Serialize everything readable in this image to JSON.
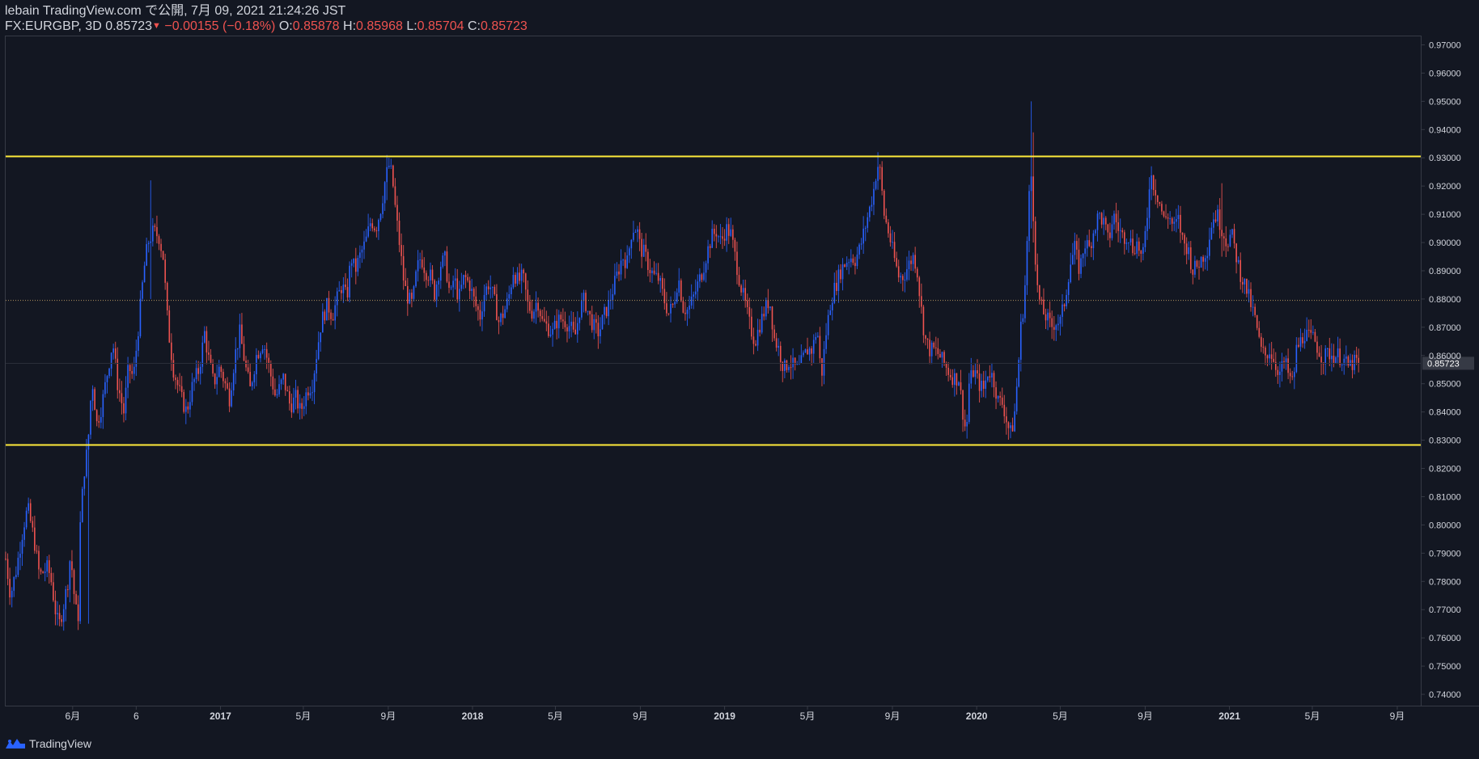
{
  "header": {
    "published_line": "lebain TradingView.com で公開, 7月 09, 2021 21:24:26 JST",
    "symbol_timeframe": "FX:EURGBP, 3D",
    "last": "0.85723",
    "down_marker": "▼",
    "change": "−0.00155 (−0.18%)",
    "o_label": "O:",
    "o_value": "0.85878",
    "h_label": "H:",
    "h_value": "0.85968",
    "l_label": "L:",
    "l_value": "0.85704",
    "c_label": "C:",
    "c_value": "0.85723"
  },
  "footer": {
    "brand": "TradingView",
    "logo_icon": "tradingview-logo-icon"
  },
  "colors": {
    "background": "#131722",
    "up": "#2962ff",
    "down": "#ef5350",
    "hline": "#ffeb3b",
    "text": "#d1d4dc",
    "axis": "#363a45"
  },
  "chart_data": {
    "type": "candlestick",
    "symbol": "FX:EURGBP",
    "timeframe": "3D",
    "y_ticks": [
      "0.97000",
      "0.96000",
      "0.95000",
      "0.94000",
      "0.93000",
      "0.92000",
      "0.91000",
      "0.90000",
      "0.89000",
      "0.88000",
      "0.87000",
      "0.86000",
      "0.85000",
      "0.84000",
      "0.83000",
      "0.82000",
      "0.81000",
      "0.80000",
      "0.79000",
      "0.78000",
      "0.77000",
      "0.76000",
      "0.75000",
      "0.74000"
    ],
    "ylim": [
      0.736,
      0.973
    ],
    "x_ticks": [
      {
        "label": "6月",
        "date": "2016-06-01"
      },
      {
        "label": "6",
        "date": "2016-09-01"
      },
      {
        "label": "2017",
        "date": "2017-01-01"
      },
      {
        "label": "5月",
        "date": "2017-05-01"
      },
      {
        "label": "9月",
        "date": "2017-09-01"
      },
      {
        "label": "2018",
        "date": "2018-01-01"
      },
      {
        "label": "5月",
        "date": "2018-05-01"
      },
      {
        "label": "9月",
        "date": "2018-09-01"
      },
      {
        "label": "2019",
        "date": "2019-01-01"
      },
      {
        "label": "5月",
        "date": "2019-05-01"
      },
      {
        "label": "9月",
        "date": "2019-09-01"
      },
      {
        "label": "2020",
        "date": "2020-01-01"
      },
      {
        "label": "5月",
        "date": "2020-05-01"
      },
      {
        "label": "9月",
        "date": "2020-09-01"
      },
      {
        "label": "2021",
        "date": "2021-01-01"
      },
      {
        "label": "5月",
        "date": "2021-05-01"
      },
      {
        "label": "9月",
        "date": "2021-09-01"
      }
    ],
    "x_range": [
      "2016-02-25",
      "2021-10-05"
    ],
    "bar_days": 3,
    "horizontal_lines": [
      {
        "price": 0.9305,
        "color": "#ffeb3b"
      },
      {
        "price": 0.8283,
        "color": "#ffeb3b"
      }
    ],
    "dotted_line": {
      "price": 0.8795,
      "color": "#b2935f"
    },
    "last_price": {
      "value": 0.85723,
      "label": "0.85723"
    },
    "last_bar_date": "2021-07-09",
    "close_path": [
      [
        "2016-02-25",
        0.788
      ],
      [
        "2016-03-03",
        0.775
      ],
      [
        "2016-03-12",
        0.785
      ],
      [
        "2016-03-22",
        0.8
      ],
      [
        "2016-03-28",
        0.806
      ],
      [
        "2016-04-06",
        0.795
      ],
      [
        "2016-04-14",
        0.782
      ],
      [
        "2016-04-26",
        0.785
      ],
      [
        "2016-05-01",
        0.78
      ],
      [
        "2016-05-08",
        0.768
      ],
      [
        "2016-05-12",
        0.764
      ],
      [
        "2016-05-20",
        0.773
      ],
      [
        "2016-05-25",
        0.78
      ],
      [
        "2016-05-29",
        0.79
      ],
      [
        "2016-06-05",
        0.77
      ],
      [
        "2016-06-09",
        0.768
      ],
      [
        "2016-06-12",
        0.8
      ],
      [
        "2016-06-17",
        0.818
      ],
      [
        "2016-06-23",
        0.828
      ],
      [
        "2016-06-29",
        0.852
      ],
      [
        "2016-07-06",
        0.836
      ],
      [
        "2016-07-13",
        0.842
      ],
      [
        "2016-07-22",
        0.855
      ],
      [
        "2016-07-29",
        0.865
      ],
      [
        "2016-08-05",
        0.85
      ],
      [
        "2016-08-14",
        0.84
      ],
      [
        "2016-08-21",
        0.856
      ],
      [
        "2016-08-28",
        0.852
      ],
      [
        "2016-09-05",
        0.872
      ],
      [
        "2016-09-12",
        0.89
      ],
      [
        "2016-09-18",
        0.9
      ],
      [
        "2016-09-26",
        0.904
      ],
      [
        "2016-10-04",
        0.902
      ],
      [
        "2016-10-10",
        0.895
      ],
      [
        "2016-10-17",
        0.87
      ],
      [
        "2016-10-25",
        0.855
      ],
      [
        "2016-11-05",
        0.845
      ],
      [
        "2016-11-13",
        0.84
      ],
      [
        "2016-11-22",
        0.85
      ],
      [
        "2016-12-01",
        0.855
      ],
      [
        "2016-12-09",
        0.868
      ],
      [
        "2016-12-14",
        0.86
      ],
      [
        "2016-12-22",
        0.85
      ],
      [
        "2016-12-31",
        0.856
      ],
      [
        "2017-01-14",
        0.845
      ],
      [
        "2017-01-22",
        0.86
      ],
      [
        "2017-01-29",
        0.868
      ],
      [
        "2017-02-07",
        0.855
      ],
      [
        "2017-02-13",
        0.848
      ],
      [
        "2017-02-22",
        0.86
      ],
      [
        "2017-03-04",
        0.865
      ],
      [
        "2017-03-13",
        0.855
      ],
      [
        "2017-03-22",
        0.845
      ],
      [
        "2017-04-02",
        0.852
      ],
      [
        "2017-04-12",
        0.842
      ],
      [
        "2017-04-20",
        0.845
      ],
      [
        "2017-04-27",
        0.84
      ],
      [
        "2017-05-07",
        0.848
      ],
      [
        "2017-05-14",
        0.85
      ],
      [
        "2017-05-21",
        0.862
      ],
      [
        "2017-05-27",
        0.872
      ],
      [
        "2017-06-05",
        0.878
      ],
      [
        "2017-06-12",
        0.874
      ],
      [
        "2017-06-19",
        0.88
      ],
      [
        "2017-06-26",
        0.885
      ],
      [
        "2017-07-03",
        0.88
      ],
      [
        "2017-07-09",
        0.895
      ],
      [
        "2017-07-15",
        0.89
      ],
      [
        "2017-07-23",
        0.896
      ],
      [
        "2017-07-30",
        0.9
      ],
      [
        "2017-08-07",
        0.908
      ],
      [
        "2017-08-14",
        0.905
      ],
      [
        "2017-08-22",
        0.913
      ],
      [
        "2017-08-28",
        0.923
      ],
      [
        "2017-09-03",
        0.928
      ],
      [
        "2017-09-08",
        0.92
      ],
      [
        "2017-09-12",
        0.91
      ],
      [
        "2017-09-18",
        0.898
      ],
      [
        "2017-09-24",
        0.885
      ],
      [
        "2017-09-30",
        0.88
      ],
      [
        "2017-10-06",
        0.878
      ],
      [
        "2017-10-12",
        0.89
      ],
      [
        "2017-10-18",
        0.895
      ],
      [
        "2017-10-25",
        0.89
      ],
      [
        "2017-11-01",
        0.888
      ],
      [
        "2017-11-07",
        0.882
      ],
      [
        "2017-11-15",
        0.892
      ],
      [
        "2017-11-22",
        0.894
      ],
      [
        "2017-11-30",
        0.88
      ],
      [
        "2017-12-05",
        0.888
      ],
      [
        "2017-12-12",
        0.88
      ],
      [
        "2017-12-20",
        0.888
      ],
      [
        "2017-12-28",
        0.885
      ],
      [
        "2018-01-05",
        0.878
      ],
      [
        "2018-01-12",
        0.874
      ],
      [
        "2018-01-18",
        0.882
      ],
      [
        "2018-01-25",
        0.886
      ],
      [
        "2018-02-01",
        0.88
      ],
      [
        "2018-02-08",
        0.872
      ],
      [
        "2018-02-15",
        0.875
      ],
      [
        "2018-02-22",
        0.88
      ],
      [
        "2018-03-01",
        0.89
      ],
      [
        "2018-03-08",
        0.886
      ],
      [
        "2018-03-15",
        0.888
      ],
      [
        "2018-03-22",
        0.878
      ],
      [
        "2018-03-29",
        0.875
      ],
      [
        "2018-04-05",
        0.88
      ],
      [
        "2018-04-12",
        0.872
      ],
      [
        "2018-04-20",
        0.87
      ],
      [
        "2018-04-27",
        0.868
      ],
      [
        "2018-05-03",
        0.872
      ],
      [
        "2018-05-09",
        0.873
      ],
      [
        "2018-05-16",
        0.872
      ],
      [
        "2018-05-23",
        0.87
      ],
      [
        "2018-05-29",
        0.866
      ],
      [
        "2018-06-05",
        0.876
      ],
      [
        "2018-06-12",
        0.88
      ],
      [
        "2018-06-19",
        0.874
      ],
      [
        "2018-06-26",
        0.87
      ],
      [
        "2018-07-03",
        0.868
      ],
      [
        "2018-07-10",
        0.874
      ],
      [
        "2018-07-17",
        0.878
      ],
      [
        "2018-07-24",
        0.884
      ],
      [
        "2018-07-31",
        0.89
      ],
      [
        "2018-08-06",
        0.895
      ],
      [
        "2018-08-13",
        0.893
      ],
      [
        "2018-08-20",
        0.905
      ],
      [
        "2018-08-27",
        0.905
      ],
      [
        "2018-09-01",
        0.898
      ],
      [
        "2018-09-07",
        0.896
      ],
      [
        "2018-09-14",
        0.891
      ],
      [
        "2018-09-21",
        0.888
      ],
      [
        "2018-09-28",
        0.887
      ],
      [
        "2018-10-05",
        0.88
      ],
      [
        "2018-10-12",
        0.875
      ],
      [
        "2018-10-19",
        0.878
      ],
      [
        "2018-10-26",
        0.888
      ],
      [
        "2018-11-02",
        0.877
      ],
      [
        "2018-11-09",
        0.876
      ],
      [
        "2018-11-16",
        0.88
      ],
      [
        "2018-11-23",
        0.885
      ],
      [
        "2018-11-30",
        0.89
      ],
      [
        "2018-12-06",
        0.896
      ],
      [
        "2018-12-13",
        0.902
      ],
      [
        "2018-12-20",
        0.904
      ],
      [
        "2018-12-27",
        0.9
      ],
      [
        "2019-01-03",
        0.905
      ],
      [
        "2019-01-10",
        0.903
      ],
      [
        "2019-01-17",
        0.894
      ],
      [
        "2019-01-24",
        0.885
      ],
      [
        "2019-01-31",
        0.878
      ],
      [
        "2019-02-07",
        0.87
      ],
      [
        "2019-02-14",
        0.865
      ],
      [
        "2019-02-21",
        0.871
      ],
      [
        "2019-02-28",
        0.876
      ],
      [
        "2019-03-07",
        0.88
      ],
      [
        "2019-03-14",
        0.866
      ],
      [
        "2019-03-21",
        0.862
      ],
      [
        "2019-03-28",
        0.855
      ],
      [
        "2019-04-04",
        0.858
      ],
      [
        "2019-04-11",
        0.856
      ],
      [
        "2019-04-18",
        0.855
      ],
      [
        "2019-04-25",
        0.859
      ],
      [
        "2019-05-01",
        0.862
      ],
      [
        "2019-05-08",
        0.862
      ],
      [
        "2019-05-15",
        0.87
      ],
      [
        "2019-05-21",
        0.852
      ],
      [
        "2019-05-28",
        0.868
      ],
      [
        "2019-06-04",
        0.88
      ],
      [
        "2019-06-11",
        0.885
      ],
      [
        "2019-06-18",
        0.89
      ],
      [
        "2019-06-25",
        0.893
      ],
      [
        "2019-07-02",
        0.895
      ],
      [
        "2019-07-09",
        0.894
      ],
      [
        "2019-07-16",
        0.898
      ],
      [
        "2019-07-23",
        0.905
      ],
      [
        "2019-07-30",
        0.912
      ],
      [
        "2019-08-06",
        0.92
      ],
      [
        "2019-08-10",
        0.928
      ],
      [
        "2019-08-14",
        0.925
      ],
      [
        "2019-08-20",
        0.91
      ],
      [
        "2019-08-27",
        0.903
      ],
      [
        "2019-09-03",
        0.895
      ],
      [
        "2019-09-10",
        0.888
      ],
      [
        "2019-09-17",
        0.888
      ],
      [
        "2019-09-24",
        0.892
      ],
      [
        "2019-10-01",
        0.895
      ],
      [
        "2019-10-06",
        0.892
      ],
      [
        "2019-10-12",
        0.878
      ],
      [
        "2019-10-18",
        0.866
      ],
      [
        "2019-10-25",
        0.862
      ],
      [
        "2019-11-01",
        0.862
      ],
      [
        "2019-11-08",
        0.86
      ],
      [
        "2019-11-15",
        0.857
      ],
      [
        "2019-11-22",
        0.854
      ],
      [
        "2019-11-29",
        0.852
      ],
      [
        "2019-12-06",
        0.852
      ],
      [
        "2019-12-13",
        0.838
      ],
      [
        "2019-12-17",
        0.832
      ],
      [
        "2019-12-21",
        0.85
      ],
      [
        "2019-12-28",
        0.855
      ],
      [
        "2020-01-04",
        0.85
      ],
      [
        "2020-01-11",
        0.848
      ],
      [
        "2020-01-18",
        0.855
      ],
      [
        "2020-01-25",
        0.852
      ],
      [
        "2020-02-01",
        0.844
      ],
      [
        "2020-02-08",
        0.843
      ],
      [
        "2020-02-15",
        0.835
      ],
      [
        "2020-02-20",
        0.832
      ],
      [
        "2020-02-25",
        0.84
      ],
      [
        "2020-03-01",
        0.855
      ],
      [
        "2020-03-05",
        0.87
      ],
      [
        "2020-03-10",
        0.88
      ],
      [
        "2020-03-15",
        0.905
      ],
      [
        "2020-03-19",
        0.928
      ],
      [
        "2020-03-23",
        0.91
      ],
      [
        "2020-03-28",
        0.885
      ],
      [
        "2020-04-02",
        0.878
      ],
      [
        "2020-04-07",
        0.875
      ],
      [
        "2020-04-12",
        0.873
      ],
      [
        "2020-04-18",
        0.87
      ],
      [
        "2020-04-24",
        0.872
      ],
      [
        "2020-05-01",
        0.872
      ],
      [
        "2020-05-08",
        0.88
      ],
      [
        "2020-05-15",
        0.892
      ],
      [
        "2020-05-22",
        0.898
      ],
      [
        "2020-05-29",
        0.89
      ],
      [
        "2020-06-05",
        0.9
      ],
      [
        "2020-06-12",
        0.898
      ],
      [
        "2020-06-19",
        0.905
      ],
      [
        "2020-06-26",
        0.91
      ],
      [
        "2020-07-03",
        0.907
      ],
      [
        "2020-07-10",
        0.9
      ],
      [
        "2020-07-17",
        0.91
      ],
      [
        "2020-07-24",
        0.905
      ],
      [
        "2020-07-31",
        0.902
      ],
      [
        "2020-08-07",
        0.903
      ],
      [
        "2020-08-14",
        0.898
      ],
      [
        "2020-08-21",
        0.9
      ],
      [
        "2020-08-28",
        0.893
      ],
      [
        "2020-09-04",
        0.91
      ],
      [
        "2020-09-08",
        0.925
      ],
      [
        "2020-09-14",
        0.92
      ],
      [
        "2020-09-21",
        0.915
      ],
      [
        "2020-09-28",
        0.908
      ],
      [
        "2020-10-05",
        0.91
      ],
      [
        "2020-10-12",
        0.905
      ],
      [
        "2020-10-19",
        0.908
      ],
      [
        "2020-10-26",
        0.9
      ],
      [
        "2020-11-02",
        0.898
      ],
      [
        "2020-11-09",
        0.89
      ],
      [
        "2020-11-16",
        0.892
      ],
      [
        "2020-11-23",
        0.895
      ],
      [
        "2020-11-30",
        0.898
      ],
      [
        "2020-12-07",
        0.908
      ],
      [
        "2020-12-14",
        0.91
      ],
      [
        "2020-12-21",
        0.905
      ],
      [
        "2020-12-28",
        0.9
      ],
      [
        "2021-01-04",
        0.903
      ],
      [
        "2021-01-11",
        0.895
      ],
      [
        "2021-01-18",
        0.888
      ],
      [
        "2021-01-25",
        0.884
      ],
      [
        "2021-02-01",
        0.878
      ],
      [
        "2021-02-08",
        0.872
      ],
      [
        "2021-02-15",
        0.862
      ],
      [
        "2021-02-22",
        0.86
      ],
      [
        "2021-03-01",
        0.862
      ],
      [
        "2021-03-08",
        0.857
      ],
      [
        "2021-03-15",
        0.854
      ],
      [
        "2021-03-22",
        0.858
      ],
      [
        "2021-03-29",
        0.852
      ],
      [
        "2021-04-03",
        0.85
      ],
      [
        "2021-04-08",
        0.862
      ],
      [
        "2021-04-14",
        0.865
      ],
      [
        "2021-04-20",
        0.868
      ],
      [
        "2021-04-27",
        0.866
      ],
      [
        "2021-05-03",
        0.866
      ],
      [
        "2021-05-10",
        0.862
      ],
      [
        "2021-05-17",
        0.859
      ],
      [
        "2021-05-24",
        0.861
      ],
      [
        "2021-05-31",
        0.86
      ],
      [
        "2021-06-07",
        0.86
      ],
      [
        "2021-06-14",
        0.859
      ],
      [
        "2021-06-21",
        0.856
      ],
      [
        "2021-06-28",
        0.857
      ],
      [
        "2021-07-05",
        0.858
      ],
      [
        "2021-07-09",
        0.85723
      ]
    ],
    "spikes": [
      {
        "date": "2016-06-24",
        "high": 0.832,
        "low": 0.765
      },
      {
        "date": "2016-09-23",
        "high": 0.922,
        "low": 0.88
      },
      {
        "date": "2017-08-29",
        "high": 0.93,
        "low": 0.915
      },
      {
        "date": "2019-08-11",
        "high": 0.932,
        "low": 0.92
      },
      {
        "date": "2020-03-19",
        "high": 0.95,
        "low": 0.905
      },
      {
        "date": "2020-03-23",
        "high": 0.939,
        "low": 0.9
      },
      {
        "date": "2020-09-09",
        "high": 0.927,
        "low": 0.915
      },
      {
        "date": "2020-12-20",
        "high": 0.921,
        "low": 0.895
      }
    ]
  }
}
